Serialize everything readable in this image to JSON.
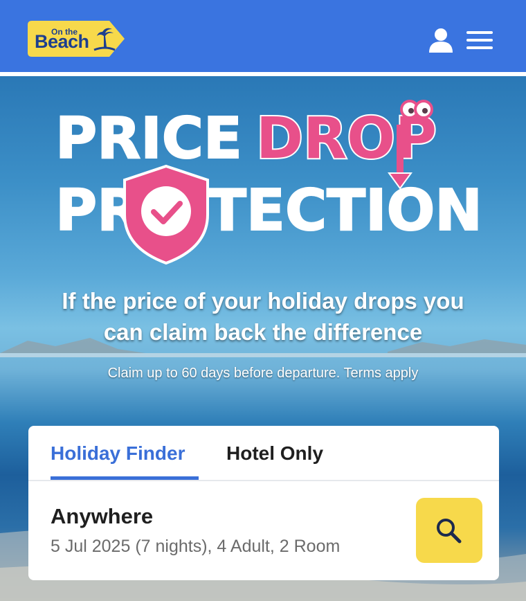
{
  "header": {
    "logo": {
      "small_text": "On the",
      "main_text": "Beach"
    },
    "user_icon": "user-icon",
    "menu_icon": "hamburger-menu-icon"
  },
  "hero": {
    "headline_word_1": "PRICE",
    "headline_word_2": "DROP",
    "headline_word_3_part_1": "PR",
    "headline_word_3_part_2": "TECTION",
    "line_1": "If the price of your holiday drops you",
    "line_2": "can claim back the difference",
    "small_print": "Claim up to 60 days before departure. Terms apply"
  },
  "search_card": {
    "tabs": [
      {
        "label": "Holiday Finder",
        "active": true
      },
      {
        "label": "Hotel Only",
        "active": false
      }
    ],
    "destination": "Anywhere",
    "details": "5 Jul 2025 (7 nights), 4 Adult, 2 Room",
    "search_icon": "search-icon"
  },
  "colors": {
    "header_bg": "#3a74e0",
    "logo_yellow": "#f7d94b",
    "accent_blue": "#3a6fd8",
    "pink": "#e8508a",
    "search_button": "#f7d94b"
  }
}
